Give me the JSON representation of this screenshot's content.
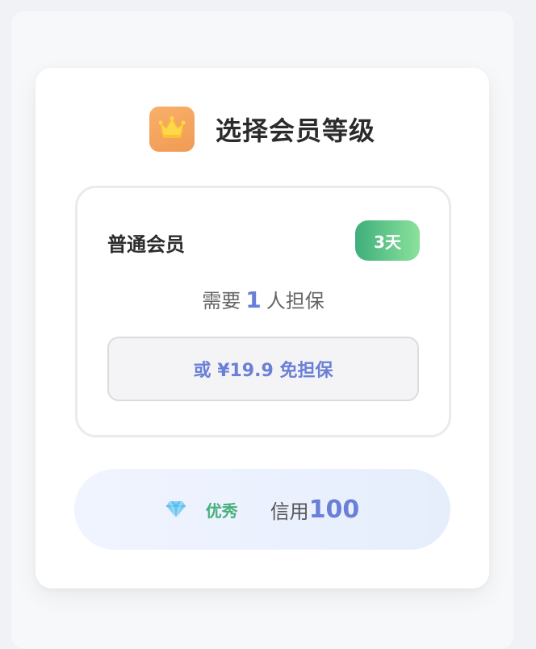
{
  "header": {
    "title": "选择会员等级",
    "icon": "crown-icon",
    "icon_bg": "#f3a15c"
  },
  "tier": {
    "name": "普通会员",
    "days_badge": "3天",
    "guarantee_prefix": "需要",
    "guarantee_count": "1",
    "guarantee_suffix": "人担保",
    "free_option_label": "或 ¥19.9 免担保"
  },
  "credit": {
    "icon": "diamond-icon",
    "level": "优秀",
    "label": "信用",
    "value": "100"
  },
  "colors": {
    "accent_blue": "#6a7fd6",
    "badge_green_start": "#3fae7c",
    "badge_green_end": "#8be29c",
    "level_green": "#47b07c"
  }
}
